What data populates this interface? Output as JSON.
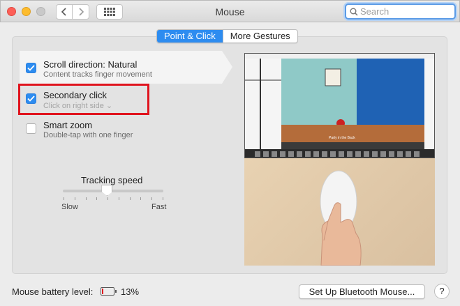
{
  "window": {
    "title": "Mouse",
    "search_placeholder": "Search"
  },
  "tabs": [
    {
      "label": "Point & Click",
      "active": true
    },
    {
      "label": "More Gestures",
      "active": false
    }
  ],
  "options": [
    {
      "title": "Scroll direction: Natural",
      "subtitle": "Content tracks finger movement",
      "checked": true
    },
    {
      "title": "Secondary click",
      "subtitle": "Click on right side ⌄",
      "checked": true
    },
    {
      "title": "Smart zoom",
      "subtitle": "Double-tap with one finger",
      "checked": false
    }
  ],
  "tracking": {
    "label": "Tracking speed",
    "slow": "Slow",
    "fast": "Fast",
    "tick_count": 10,
    "value_fraction": 0.44
  },
  "preview": {
    "caption": "Party in the Back"
  },
  "footer": {
    "battery_label": "Mouse battery level:",
    "battery_pct": "13%",
    "battery_fraction": 0.13,
    "bluetooth_button": "Set Up Bluetooth Mouse...",
    "help": "?"
  },
  "colors": {
    "accent": "#2d8cf0",
    "highlight": "#e0141e"
  }
}
